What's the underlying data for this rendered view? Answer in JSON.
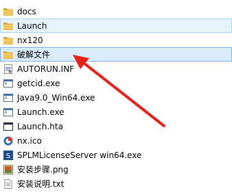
{
  "files": [
    {
      "name": "docs",
      "icon": "folder-icon",
      "state": "normal"
    },
    {
      "name": "Launch",
      "icon": "folder-icon",
      "state": "highlight"
    },
    {
      "name": "nx120",
      "icon": "folder-icon",
      "state": "normal"
    },
    {
      "name": "破解文件",
      "icon": "folder-icon",
      "state": "selected"
    },
    {
      "name": "AUTORUN.INF",
      "icon": "settings-file-icon",
      "state": "normal"
    },
    {
      "name": "getcid.exe",
      "icon": "exe-icon",
      "state": "normal"
    },
    {
      "name": "Java9.0_Win64.exe",
      "icon": "exe-icon",
      "state": "normal"
    },
    {
      "name": "Launch.exe",
      "icon": "exe-icon",
      "state": "normal"
    },
    {
      "name": "Launch.hta",
      "icon": "hta-icon",
      "state": "normal"
    },
    {
      "name": "nx.ico",
      "icon": "nx-ico-icon",
      "state": "normal"
    },
    {
      "name": "SPLMLicenseServer win64.exe",
      "icon": "installer-icon",
      "state": "normal"
    },
    {
      "name": "安装步骤.png",
      "icon": "image-file-icon",
      "state": "normal"
    },
    {
      "name": "安装说明.txt",
      "icon": "text-file-icon",
      "state": "normal"
    }
  ],
  "annotation": {
    "arrow_color": "#e8201a"
  },
  "colors": {
    "folder": "#f2c65a",
    "folder_dark": "#d9a83a",
    "highlight_bg": "#e5f3fb",
    "selected_bg": "#d9ebf9"
  }
}
